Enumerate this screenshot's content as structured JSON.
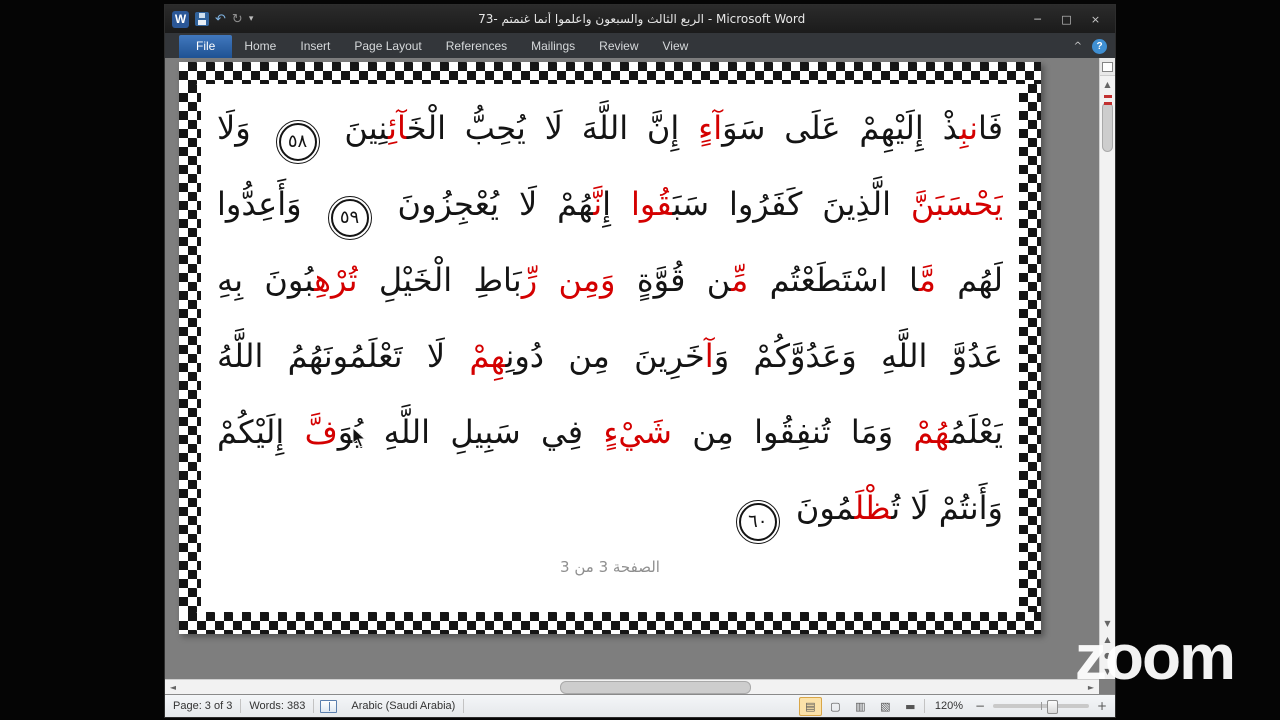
{
  "window": {
    "title": "الربع الثالث والسبعون واعلموا أنما غنمتم -73 - Microsoft Word",
    "quick_access": {
      "logo": "W",
      "undo": "↶",
      "redo": "↻",
      "dropdown": "▾"
    },
    "controls": {
      "minimize": "─",
      "maximize": "□",
      "close": "×"
    }
  },
  "ribbon": {
    "file_tab": "File",
    "tabs": [
      "Home",
      "Insert",
      "Page Layout",
      "References",
      "Mailings",
      "Review",
      "View"
    ],
    "minimize_glyph": "^",
    "help": "?"
  },
  "document": {
    "lines": [
      {
        "segments": [
          {
            "t": "فَا"
          },
          {
            "t": "نبِ",
            "c": "red"
          },
          {
            "t": "ذْ إِلَيْهِمْ عَلَى سَوَ"
          },
          {
            "t": "آءٍ",
            "c": "red"
          },
          {
            "t": " إِنَّ اللَّهَ لَا يُحِبُّ الْخَ"
          },
          {
            "t": "آئِ",
            "c": "red"
          },
          {
            "t": "نِينَ "
          },
          {
            "t": "٥٨",
            "badge": true
          },
          {
            "t": " وَلَا"
          }
        ]
      },
      {
        "segments": [
          {
            "t": "يَحْسَبَنَّ",
            "c": "red"
          },
          {
            "t": " الَّذِينَ كَفَرُوا سَبَ"
          },
          {
            "t": "قُوا",
            "c": "red"
          },
          {
            "t": " إِ"
          },
          {
            "t": "نَّ",
            "c": "red"
          },
          {
            "t": "هُمْ لَا يُعْجِزُونَ "
          },
          {
            "t": "٥٩",
            "badge": true
          },
          {
            "t": " وَأَعِدُّوا"
          }
        ]
      },
      {
        "segments": [
          {
            "t": "لَهُم "
          },
          {
            "t": "مَّ",
            "c": "red"
          },
          {
            "t": "ا اسْتَطَعْتُم "
          },
          {
            "t": "مِّ",
            "c": "red"
          },
          {
            "t": "ن قُوَّةٍ "
          },
          {
            "t": "وَمِن رِّ",
            "c": "red"
          },
          {
            "t": "بَاطِ الْخَيْلِ "
          },
          {
            "t": "تُرْهِ",
            "c": "red"
          },
          {
            "t": "بُونَ بِهِ"
          }
        ]
      },
      {
        "segments": [
          {
            "t": "عَدُوَّ اللَّهِ وَعَدُوَّكُمْ وَ"
          },
          {
            "t": "آ",
            "c": "red"
          },
          {
            "t": "خَرِينَ مِن دُونِ"
          },
          {
            "t": "هِمْ",
            "c": "red"
          },
          {
            "t": " لَا تَعْلَمُونَهُمُ اللَّهُ"
          }
        ]
      },
      {
        "segments": [
          {
            "t": "يَعْلَمُ"
          },
          {
            "t": "هُمْ",
            "c": "red"
          },
          {
            "t": " وَمَا تُنفِقُوا مِن "
          },
          {
            "t": "شَيْءٍ",
            "c": "red"
          },
          {
            "t": " فِي سَبِيلِ اللَّهِ يُوَ"
          },
          {
            "t": "فَّ",
            "c": "red"
          },
          {
            "t": " إِلَيْكُمْ"
          }
        ]
      },
      {
        "segments": [
          {
            "t": "وَأَنتُمْ لَا تُ"
          },
          {
            "t": "ظْلَ",
            "c": "red"
          },
          {
            "t": "مُونَ "
          },
          {
            "t": "٦٠",
            "badge": true
          }
        ]
      }
    ],
    "footer": "الصفحة 3 من 3"
  },
  "scrollbar": {
    "up": "▲",
    "down": "▼",
    "left": "◄",
    "right": "►",
    "prev_page": "▲",
    "browse_select": "●",
    "next_page": "▼"
  },
  "status_bar": {
    "page": "Page: 3 of 3",
    "words": "Words: 383",
    "language": "Arabic (Saudi Arabia)",
    "view_buttons": [
      {
        "name": "print-layout",
        "glyph": "▤"
      },
      {
        "name": "full-screen-reading",
        "glyph": "▢"
      },
      {
        "name": "web-layout",
        "glyph": "▥"
      },
      {
        "name": "outline",
        "glyph": "▧"
      },
      {
        "name": "draft",
        "glyph": "▬"
      }
    ],
    "zoom_level": "120%",
    "zoom_out": "−",
    "zoom_in": "+"
  },
  "watermark": "zoom",
  "colors": {
    "file_tab_blue": "#2a5ca8",
    "tajweed_red": "#d40000",
    "view_active_bg": "#fbe2a9",
    "titlebar_dark": "#1b1b1b"
  }
}
